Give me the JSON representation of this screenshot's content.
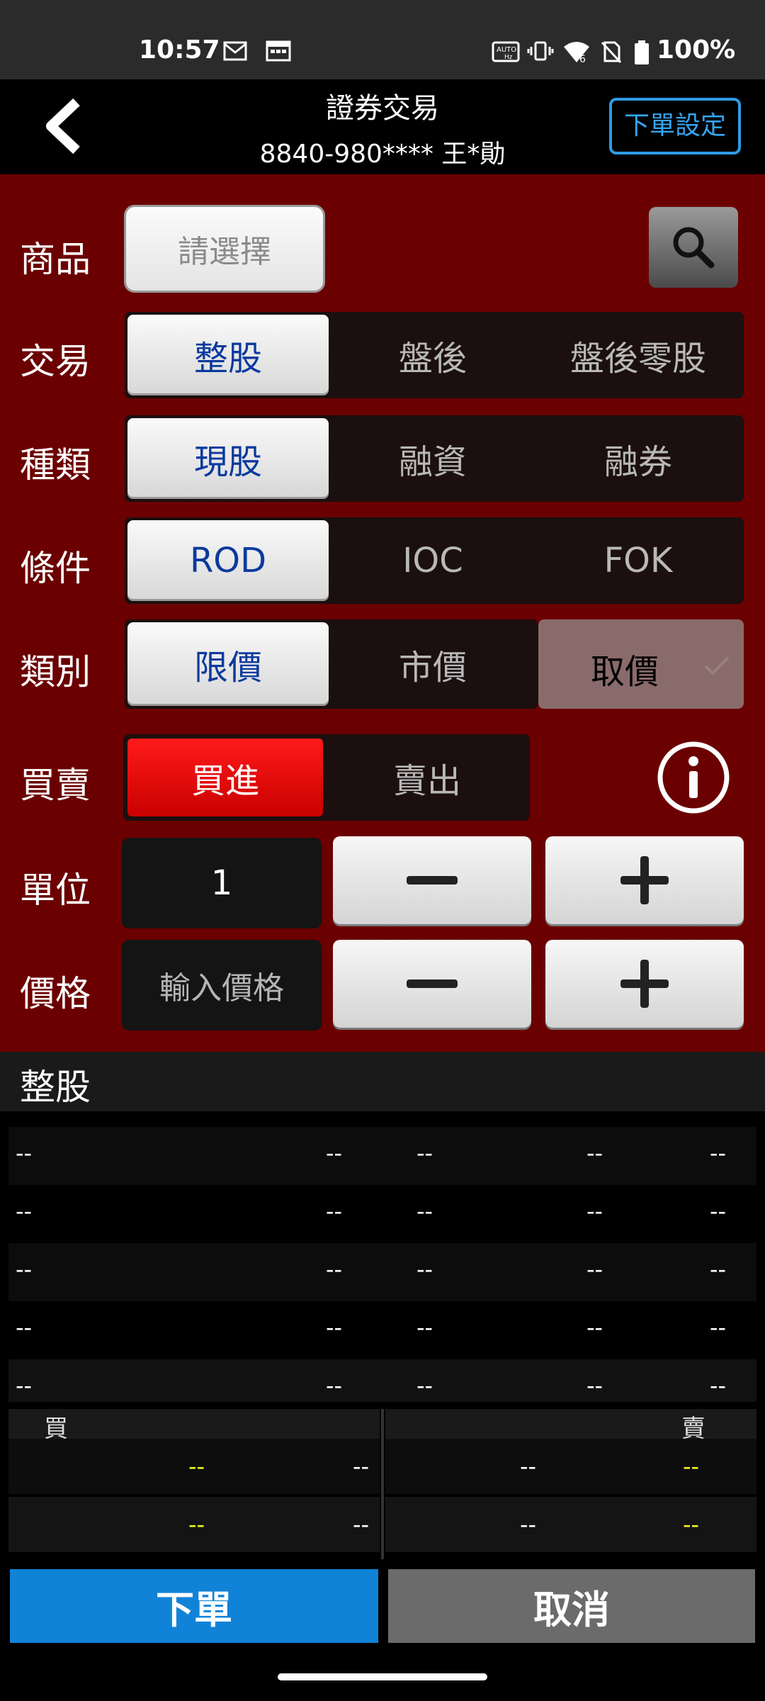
{
  "status": {
    "time": "10:57",
    "battery": "100%",
    "signal_label": "6"
  },
  "header": {
    "title": "證券交易",
    "account": "8840-980**** 王*勛",
    "settings_button": "下單設定"
  },
  "form": {
    "product": {
      "label": "商品",
      "placeholder": "請選擇"
    },
    "trade": {
      "label": "交易",
      "options": [
        "整股",
        "盤後",
        "盤後零股"
      ],
      "selected": "整股"
    },
    "type": {
      "label": "種類",
      "options": [
        "現股",
        "融資",
        "融券"
      ],
      "selected": "現股"
    },
    "condition": {
      "label": "條件",
      "options": [
        "ROD",
        "IOC",
        "FOK"
      ],
      "selected": "ROD"
    },
    "category": {
      "label": "類別",
      "options": [
        "限價",
        "市價"
      ],
      "selected": "限價",
      "quote_button": "取價"
    },
    "side": {
      "label": "買賣",
      "options": [
        "買進",
        "賣出"
      ],
      "selected": "買進"
    },
    "unit": {
      "label": "單位",
      "value": "1",
      "minus": "−",
      "plus": "+"
    },
    "price": {
      "label": "價格",
      "placeholder": "輸入價格",
      "minus": "−",
      "plus": "+"
    }
  },
  "section": {
    "title": "整股"
  },
  "table": {
    "rows": [
      [
        "--",
        "--",
        "--",
        "--",
        "--"
      ],
      [
        "--",
        "--",
        "--",
        "--",
        "--"
      ],
      [
        "--",
        "--",
        "--",
        "--",
        "--"
      ],
      [
        "--",
        "--",
        "--",
        "--",
        "--"
      ],
      [
        "--",
        "--",
        "--",
        "--",
        "--"
      ]
    ]
  },
  "book": {
    "buy_label": "買",
    "sell_label": "賣",
    "rows": [
      [
        "--",
        "--",
        "--",
        "--"
      ],
      [
        "--",
        "--",
        "--",
        "--"
      ]
    ]
  },
  "actions": {
    "order": "下單",
    "cancel": "取消"
  },
  "colors": {
    "form_bg": "#6b0000",
    "order_btn": "#1083d8",
    "cancel_btn": "#6b6b6b",
    "settings_border": "#2f9be6",
    "yellow_value": "#f5f51e"
  }
}
